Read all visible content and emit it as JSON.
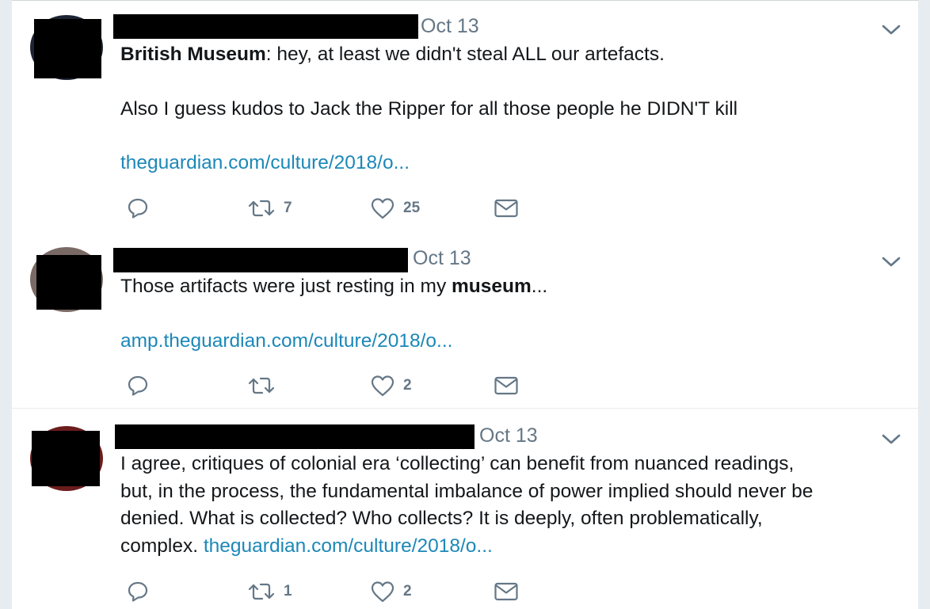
{
  "tweets": [
    {
      "date": "Oct 13",
      "quoted_user": "British Museum",
      "text_after_user": ": hey, at least we didn't steal ALL our artefacts.",
      "text_para2": "Also I guess kudos to Jack the Ripper for all those people he DIDN'T kill",
      "link": "theguardian.com/culture/2018/o...",
      "retweets": "7",
      "likes": "25"
    },
    {
      "date": "Oct 13",
      "text_before_bold": "Those artifacts were just resting in my ",
      "bold": "museum",
      "text_after_bold": "...",
      "link": "amp.theguardian.com/culture/2018/o...",
      "retweets": "",
      "likes": "2"
    },
    {
      "date": "Oct 13",
      "lines": [
        "I agree,  critiques of colonial era ‘collecting’ can benefit from nuanced readings,",
        "but,  in the process, the fundamental imbalance of power implied should never be",
        "denied. What is collected? Who collects? It is deeply, often problematically,",
        "complex. "
      ],
      "link": "theguardian.com/culture/2018/o...",
      "retweets": "1",
      "likes": "2"
    }
  ],
  "icons": {
    "reply": "reply-icon",
    "retweet": "retweet-icon",
    "like": "heart-icon",
    "message": "envelope-icon",
    "more": "chevron-down-icon"
  },
  "colors": {
    "link": "#1c88b8",
    "muted": "#657786",
    "redaction": "#000000"
  }
}
